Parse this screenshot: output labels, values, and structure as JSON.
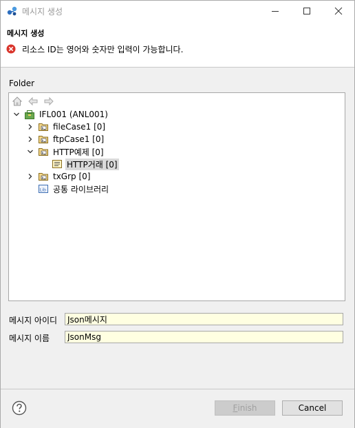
{
  "window": {
    "title": "메시지 생성"
  },
  "header": {
    "title": "메시지 생성",
    "error_message": "리소스 ID는 영어와 숫자만 입력이 가능합니다."
  },
  "folder": {
    "label": "Folder",
    "toolbar": [
      "home-icon",
      "back-icon",
      "forward-icon"
    ],
    "tree": [
      {
        "label": "IFL001  (ANL001)",
        "icon": "project-icon",
        "expanded": true
      },
      {
        "label": "fileCase1 [0]",
        "icon": "folder-icon",
        "expanded": false
      },
      {
        "label": "ftpCase1 [0]",
        "icon": "folder-icon",
        "expanded": false
      },
      {
        "label": "HTTP예제 [0]",
        "icon": "folder-icon",
        "expanded": true
      },
      {
        "label": "HTTP거래 [0]",
        "icon": "message-icon",
        "selected": true
      },
      {
        "label": "txGrp [0]",
        "icon": "folder-icon",
        "expanded": false
      },
      {
        "label": "공통 라이브러리",
        "icon": "library-icon"
      }
    ]
  },
  "form": {
    "message_id_label": "메시지 아이디",
    "message_id_value": "Json메시지",
    "message_name_label": "메시지 이름",
    "message_name_value": "JsonMsg"
  },
  "buttons": {
    "finish_mnemonic": "F",
    "finish_rest": "inish",
    "cancel": "Cancel"
  },
  "colors": {
    "error": "#d9342b",
    "input_bg": "#ffffe1",
    "selected_bg": "#dadada"
  }
}
